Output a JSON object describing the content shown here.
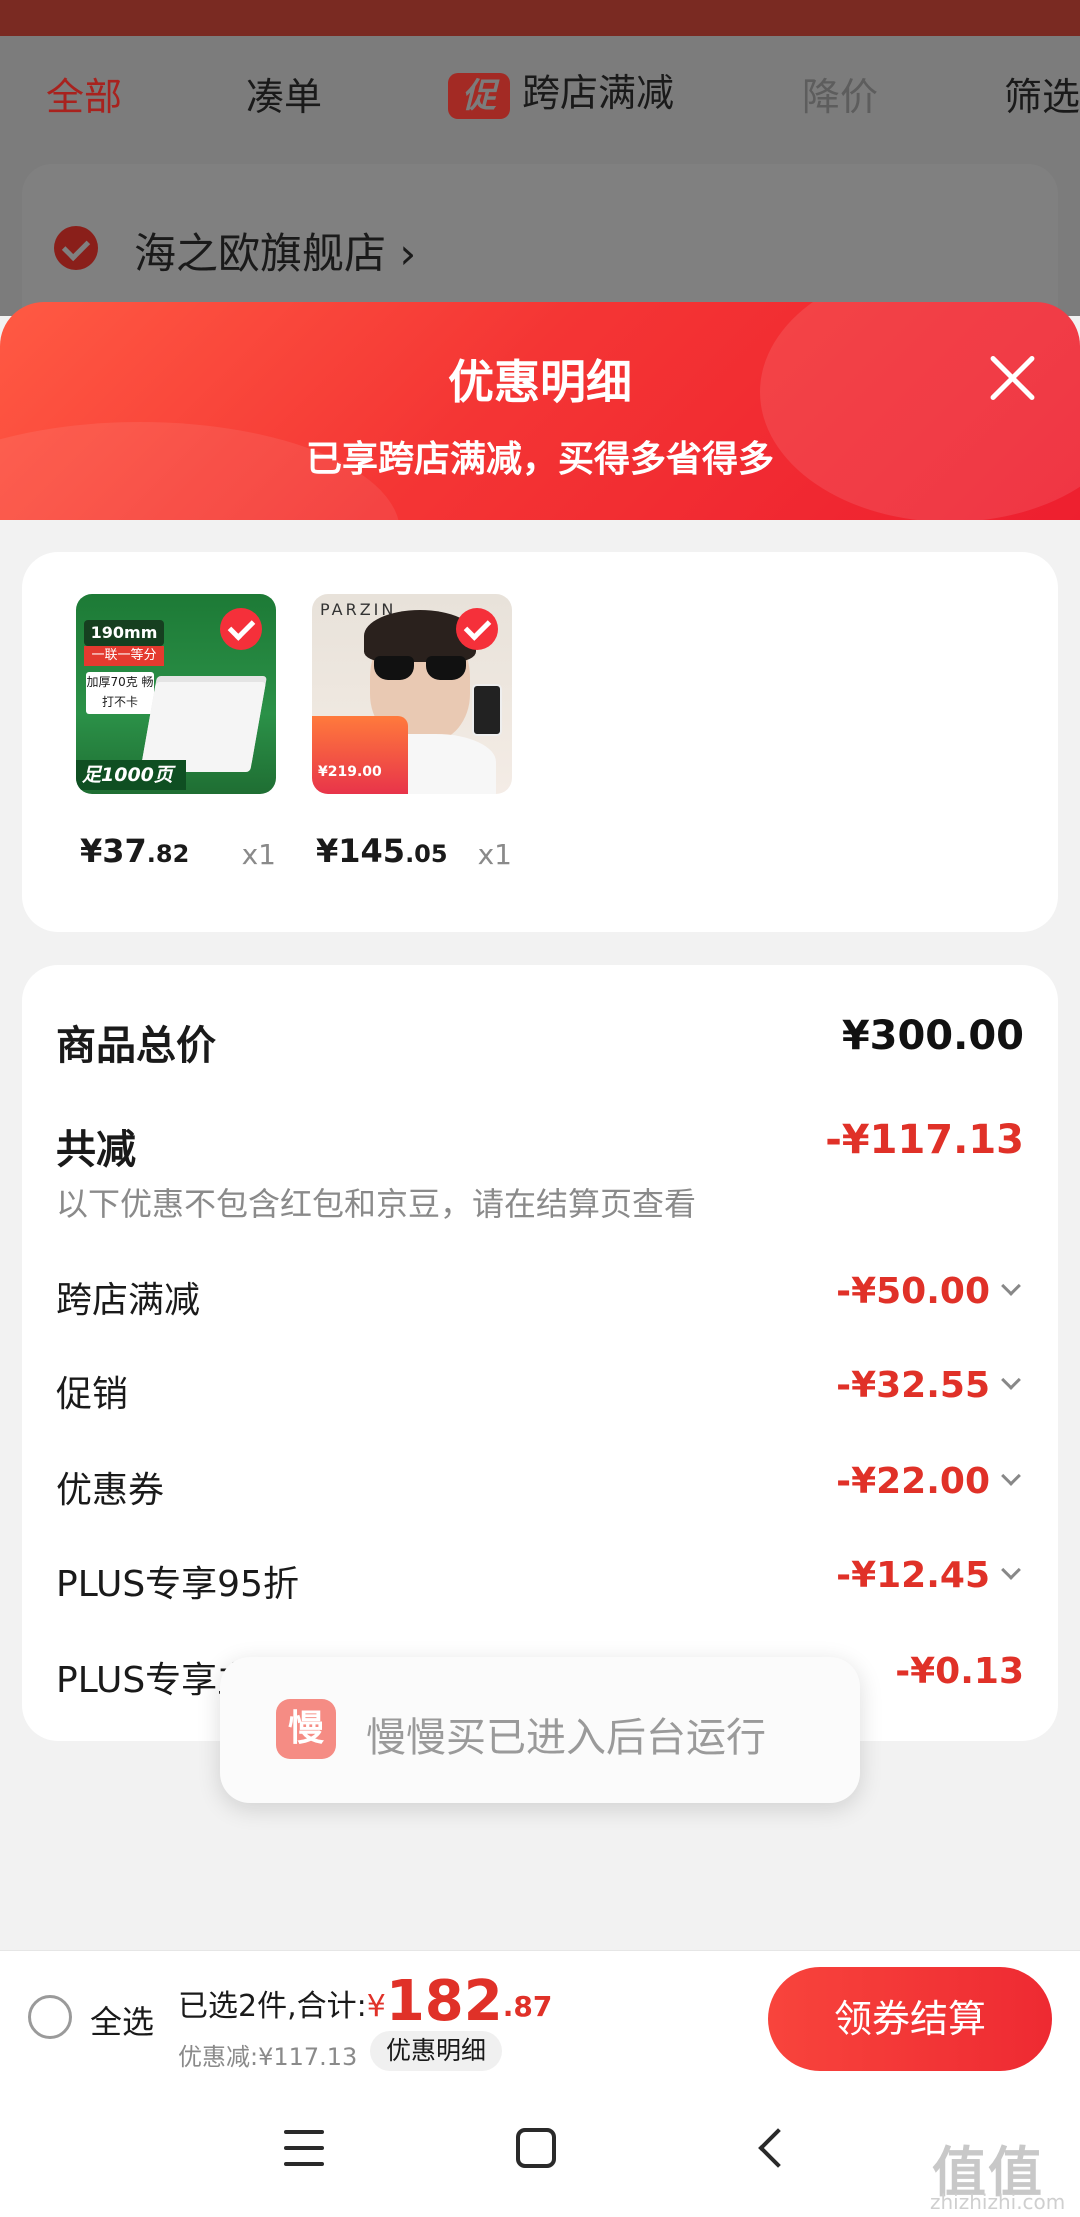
{
  "background_tabs": [
    {
      "label": "全部",
      "state": "active"
    },
    {
      "label": "凑单",
      "state": "normal"
    },
    {
      "label": "跨店满减",
      "state": "normal",
      "badge": "促"
    },
    {
      "label": "降价",
      "state": "disabled"
    },
    {
      "label": "筛选",
      "state": "normal"
    }
  ],
  "store": {
    "name": "海之欧旗舰店 ›"
  },
  "sheet": {
    "title": "优惠明细",
    "subtitle": "已享跨店满减，买得多省得多"
  },
  "products": [
    {
      "price_int": "¥37",
      "price_dec": ".82",
      "qty": "x1",
      "thumb": {
        "tag1": "190mm",
        "tag2": "一联一等分",
        "tag3": "加厚70克 畅打不卡",
        "tag4": "足1000页"
      }
    },
    {
      "price_int": "¥145",
      "price_dec": ".05",
      "qty": "x1",
      "thumb": {
        "brand": "PARZIN",
        "price": "¥219.00"
      }
    }
  ],
  "summary": {
    "total_label": "商品总价",
    "total_value": "¥300.00",
    "reduce_label": "共减",
    "reduce_value": "-¥117.13",
    "note": "以下优惠不包含红包和京豆，请在结算页查看",
    "items": [
      {
        "label": "跨店满减",
        "value": "-¥50.00",
        "expandable": true
      },
      {
        "label": "促销",
        "value": "-¥32.55",
        "expandable": true
      },
      {
        "label": "优惠券",
        "value": "-¥22.00",
        "expandable": true
      },
      {
        "label": "PLUS专享95折",
        "value": "-¥12.45",
        "expandable": true
      },
      {
        "label": "PLUS专享立减",
        "value": "-¥0.13",
        "expandable": false
      }
    ]
  },
  "toast": {
    "icon": "慢",
    "text": "慢慢买已进入后台运行"
  },
  "bottom_bar": {
    "select_all": "全选",
    "selected_prefix": "已选2件,合计:",
    "currency": "¥",
    "total_int": "182",
    "total_dec": ".87",
    "discount": "优惠减:¥117.13",
    "detail_chip": "优惠明细",
    "checkout": "领券结算"
  },
  "watermark": {
    "main": "值值值",
    "sub": "zhizhizhi.com"
  },
  "colors": {
    "accent": "#E03128",
    "header_red": "#F43534",
    "button_red": "#F8443C"
  },
  "icons": [
    "close-icon",
    "check-icon",
    "chevron-down-icon",
    "menu-icon",
    "home-icon",
    "back-icon"
  ]
}
